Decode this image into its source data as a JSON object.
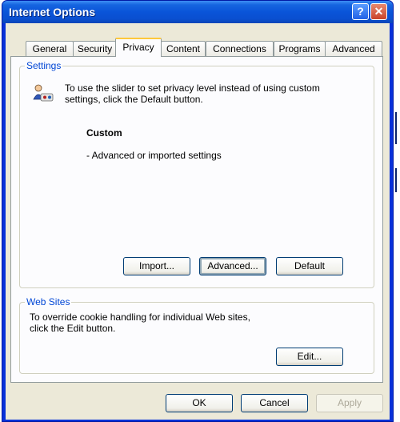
{
  "window": {
    "title": "Internet Options"
  },
  "tabs": [
    {
      "label": "General"
    },
    {
      "label": "Security"
    },
    {
      "label": "Privacy"
    },
    {
      "label": "Content"
    },
    {
      "label": "Connections"
    },
    {
      "label": "Programs"
    },
    {
      "label": "Advanced"
    }
  ],
  "settings": {
    "legend": "Settings",
    "instruction_line1": "To use the slider to set privacy level instead of using custom",
    "instruction_line2": "settings, click the Default button.",
    "level_name": "Custom",
    "level_desc": "- Advanced or imported settings",
    "import_label": "Import...",
    "advanced_label": "Advanced...",
    "default_label": "Default"
  },
  "websites": {
    "legend": "Web Sites",
    "text_line1": "To override cookie handling for individual Web sites,",
    "text_line2": "click the Edit button.",
    "edit_label": "Edit..."
  },
  "footer": {
    "ok_label": "OK",
    "cancel_label": "Cancel",
    "apply_label": "Apply"
  },
  "colors": {
    "titlebar": "#0a54d9",
    "legend_text": "#0046d5",
    "active_tab_accent": "#ffc83c"
  },
  "icons": {
    "titlebar_help": "question-icon",
    "titlebar_close": "close-icon",
    "settings": "privacy-person-icon"
  }
}
